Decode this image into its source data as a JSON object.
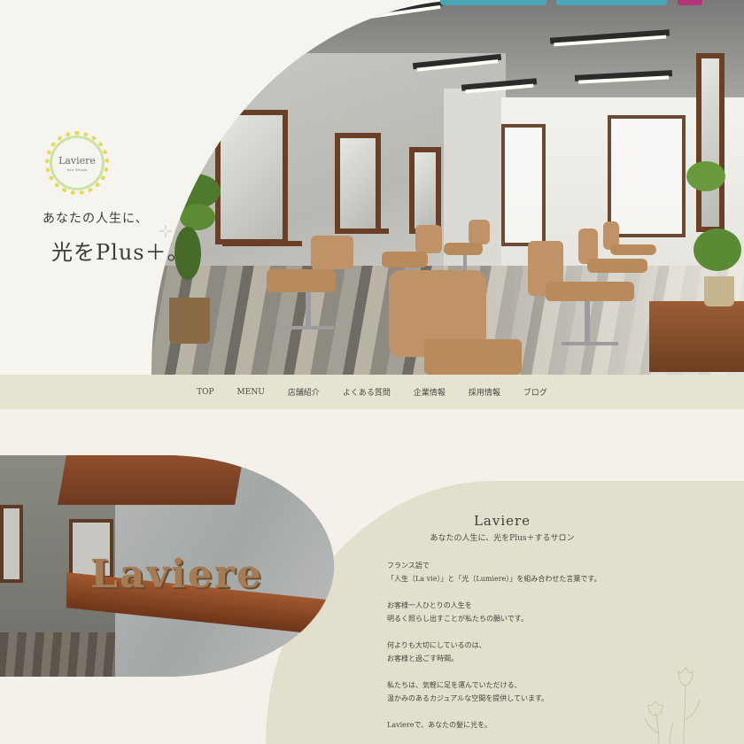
{
  "header": {
    "logo": {
      "title": "Laviere",
      "subtitle": "hair design"
    },
    "catchphrase_line1": "あなたの人生に、",
    "catchphrase_line2": "光をPlus＋。",
    "top_buttons": [
      "teal-button",
      "teal-button",
      "instagram-button"
    ]
  },
  "nav": {
    "items": [
      "TOP",
      "MENU",
      "店舗紹介",
      "よくある質問",
      "企業情報",
      "採用情報",
      "ブログ"
    ]
  },
  "about": {
    "photo_sign": "Laviere",
    "title": "Laviere",
    "subtitle": "あなたの人生に、光をPlus＋するサロン",
    "paragraphs": [
      [
        "フランス語で",
        "「人生（La vie）」と「光（Lumiere）」を組み合わせた言葉です。"
      ],
      [
        "お客様一人ひとりの人生を",
        "明るく照らし出すことが私たちの願いです。"
      ],
      [
        "何よりも大切にしているのは、",
        "お客様と過ごす時間。"
      ],
      [
        "私たちは、気軽に足を運んでいただける、",
        "温かみのあるカジュアルな空間を提供しています。"
      ],
      [
        "Laviereで、あなたの髪に光を。"
      ]
    ]
  },
  "colors": {
    "nav_bg": "#e6e3d1",
    "about_bg": "#e2dfcc",
    "page_bg": "#f4f1ea",
    "accent_teal": "#4aa6b4",
    "wood": "#6a3f28"
  }
}
